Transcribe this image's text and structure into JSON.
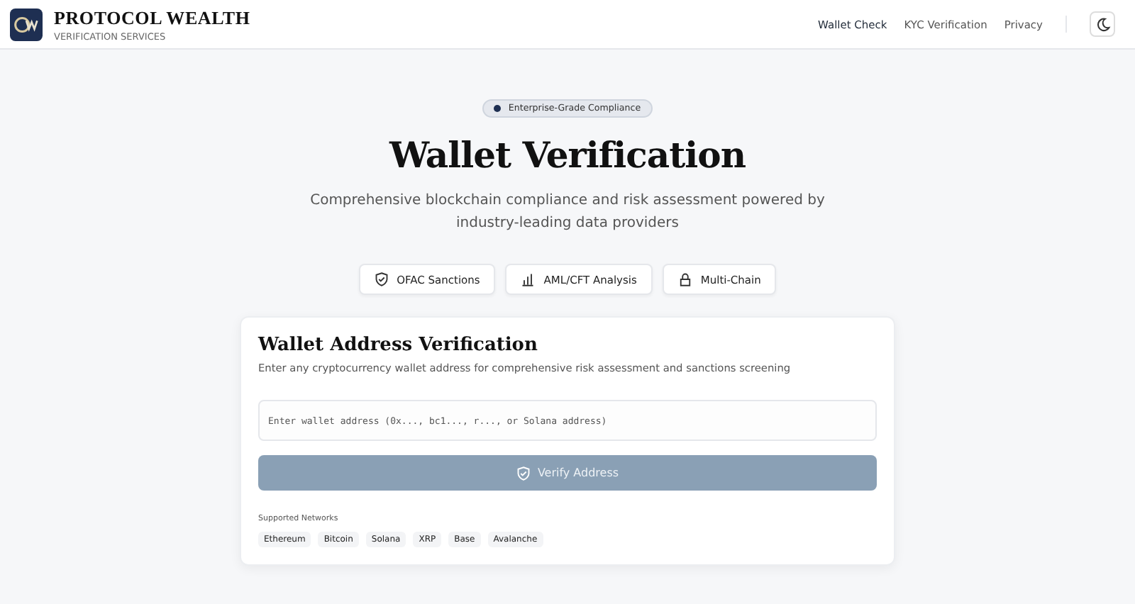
{
  "brand": {
    "name": "PROTOCOL WEALTH",
    "tagline": "VERIFICATION SERVICES"
  },
  "nav": [
    {
      "label": "Wallet Check",
      "selected": true
    },
    {
      "label": "KYC Verification",
      "selected": false
    },
    {
      "label": "Privacy",
      "selected": false
    }
  ],
  "hero": {
    "badge": "Enterprise-Grade Compliance",
    "title": "Wallet Verification",
    "subtitle": "Comprehensive blockchain compliance and risk assessment powered by industry-leading data providers",
    "features": [
      {
        "label": "OFAC Sanctions"
      },
      {
        "label": "AML/CFT Analysis"
      },
      {
        "label": "Multi-Chain"
      }
    ]
  },
  "card": {
    "title": "Wallet Address Verification",
    "description": "Enter any cryptocurrency wallet address for comprehensive risk assessment and sanctions screening",
    "placeholder": "Enter wallet address (0x..., bc1..., r..., or Solana address)",
    "button": {
      "label": "Verify Address",
      "disabled": true
    },
    "networks_label": "Supported Networks",
    "networks": [
      "Ethereum",
      "Bitcoin",
      "Solana",
      "XRP",
      "Base",
      "Avalanche"
    ]
  }
}
